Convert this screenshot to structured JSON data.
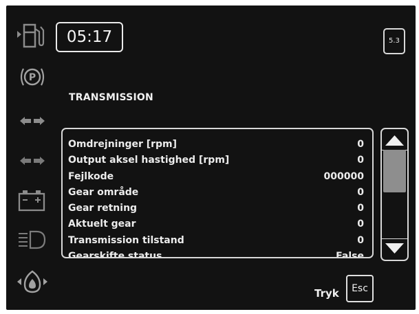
{
  "header": {
    "time": "05:17",
    "page_number": "5.3"
  },
  "section": {
    "title": "TRANSMISSION"
  },
  "rows": [
    {
      "label": "Omdrejninger [rpm]",
      "value": "0"
    },
    {
      "label": "Output aksel hastighed [rpm]",
      "value": "0"
    },
    {
      "label": "Fejlkode",
      "value": "000000"
    },
    {
      "label": "Gear område",
      "value": "0"
    },
    {
      "label": "Gear retning",
      "value": "0"
    },
    {
      "label": "Aktuelt gear",
      "value": "0"
    },
    {
      "label": "Transmission tilstand",
      "value": "0"
    },
    {
      "label": "Gearskifte status",
      "value": "False"
    }
  ],
  "footer": {
    "press_label": "Tryk",
    "esc_label": "Esc"
  },
  "icons": {
    "sidebar": [
      "fuel-icon",
      "parking-brake-icon",
      "turn-signal-icon",
      "turn-signal-icon-2",
      "battery-icon",
      "headlight-icon",
      "oil-pressure-icon"
    ],
    "scroll": [
      "scroll-up-arrow-icon",
      "scroll-down-arrow-icon"
    ]
  },
  "colors": {
    "background": "#121212",
    "foreground": "#f2f2f2",
    "scroll_thumb": "#8e8e8e",
    "icon_gray": "#8c8c8c"
  }
}
